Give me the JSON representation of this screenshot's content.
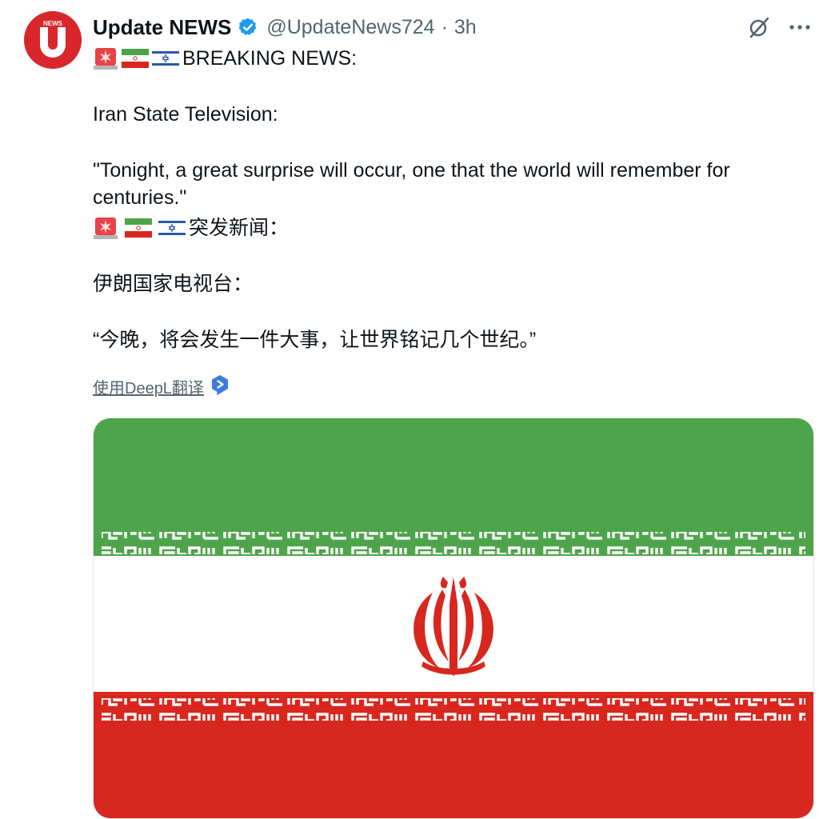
{
  "tweet": {
    "author_name": "Update NEWS",
    "handle": "@UpdateNews724",
    "separator": "·",
    "time": "3h",
    "avatar_text": "NEWS",
    "avatar_letter": "U",
    "headline_en": "BREAKING NEWS:",
    "source_en": "Iran State Television:",
    "quote_en": "\"Tonight, a great surprise will occur, one that the world will remember for centuries.\"",
    "headline_zh": "突发新闻：",
    "source_zh": "伊朗国家电视台：",
    "quote_zh": "“今晚，将会发生一件大事，让世界铭记几个世纪。”",
    "translate_link": "使用DeepL翻译"
  },
  "icons": [
    "verified-badge-icon",
    "grok-icon",
    "more-options-icon",
    "siren-icon",
    "iran-flag-icon",
    "israel-flag-icon",
    "deepl-icon"
  ],
  "colors": {
    "brand_red": "#d9262c",
    "verified_blue": "#1d9bf0",
    "flag_green": "#4ea44a",
    "flag_red": "#d7271f",
    "link_gray": "#536471"
  }
}
